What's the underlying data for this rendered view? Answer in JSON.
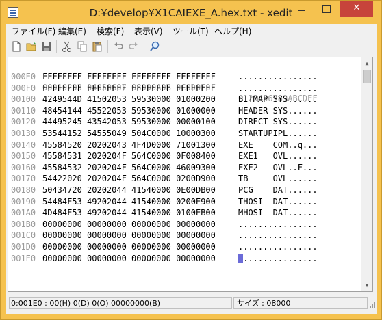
{
  "window": {
    "title": "D:¥develop¥X1CAIEXE_A.hex.txt - xedit",
    "minimize": "–",
    "maximize": "□",
    "close": "✕"
  },
  "menu": [
    "ファイル(F)",
    "編集(E)",
    "検索(F)",
    "表示(V)",
    "ツール(T)",
    "ヘルプ(H)"
  ],
  "toolbar": {
    "icons": [
      "new-file-icon",
      "open-folder-icon",
      "save-icon",
      "cut-icon",
      "copy-icon",
      "paste-icon",
      "undo-icon",
      "redo-icon",
      "search-icon"
    ]
  },
  "editor": {
    "header": {
      "addr": "",
      "data": "00010203 04050607 08090A0B 0C0D0E0F",
      "ascii": "0123456789ABCDEF"
    },
    "rows": [
      {
        "addr": "000E0",
        "data": "FFFFFFFF FFFFFFFF FFFFFFFF FFFFFFFF",
        "ascii": "................"
      },
      {
        "addr": "000F0",
        "data": "FFFFFFFF FFFFFFFF FFFFFFFF FFFFFFFF",
        "ascii": "................"
      },
      {
        "addr": "00100",
        "data": "4249544D 41502053 59530000 01000200",
        "ascii": "BITMAP SYS......"
      },
      {
        "addr": "00110",
        "data": "48454144 45522053 59530000 01000000",
        "ascii": "HEADER SYS......"
      },
      {
        "addr": "00120",
        "data": "44495245 43542053 59530000 00000100",
        "ascii": "DIRECT SYS......"
      },
      {
        "addr": "00130",
        "data": "53544152 54555049 504C0000 10000300",
        "ascii": "STARTUPIPL......"
      },
      {
        "addr": "00140",
        "data": "45584520 20202043 4F4D0000 71001300",
        "ascii": "EXE    COM..q..."
      },
      {
        "addr": "00150",
        "data": "45584531 2020204F 564C0000 0F008400",
        "ascii": "EXE1   OVL......"
      },
      {
        "addr": "00160",
        "data": "45584532 2020204F 564C0000 46009300",
        "ascii": "EXE2   OVL..F..."
      },
      {
        "addr": "00170",
        "data": "54422020 2020204F 564C0000 0200D900",
        "ascii": "TB     OVL......"
      },
      {
        "addr": "00180",
        "data": "50434720 20202044 41540000 0E00DB00",
        "ascii": "PCG    DAT......"
      },
      {
        "addr": "00190",
        "data": "54484F53 49202044 41540000 0200E900",
        "ascii": "THOSI  DAT......"
      },
      {
        "addr": "001A0",
        "data": "4D484F53 49202044 41540000 0100EB00",
        "ascii": "MHOSI  DAT......"
      },
      {
        "addr": "001B0",
        "data": "00000000 00000000 00000000 00000000",
        "ascii": "................"
      },
      {
        "addr": "001C0",
        "data": "00000000 00000000 00000000 00000000",
        "ascii": "................"
      },
      {
        "addr": "001D0",
        "data": "00000000 00000000 00000000 00000000",
        "ascii": "................"
      },
      {
        "addr": "001E0",
        "data": "00000000 00000000 00000000 00000000",
        "ascii": "................"
      }
    ]
  },
  "status": {
    "position": "0:001E0 : 00(H) 0(D) 0(O) 00000000(B)",
    "size": "サイズ : 08000"
  }
}
